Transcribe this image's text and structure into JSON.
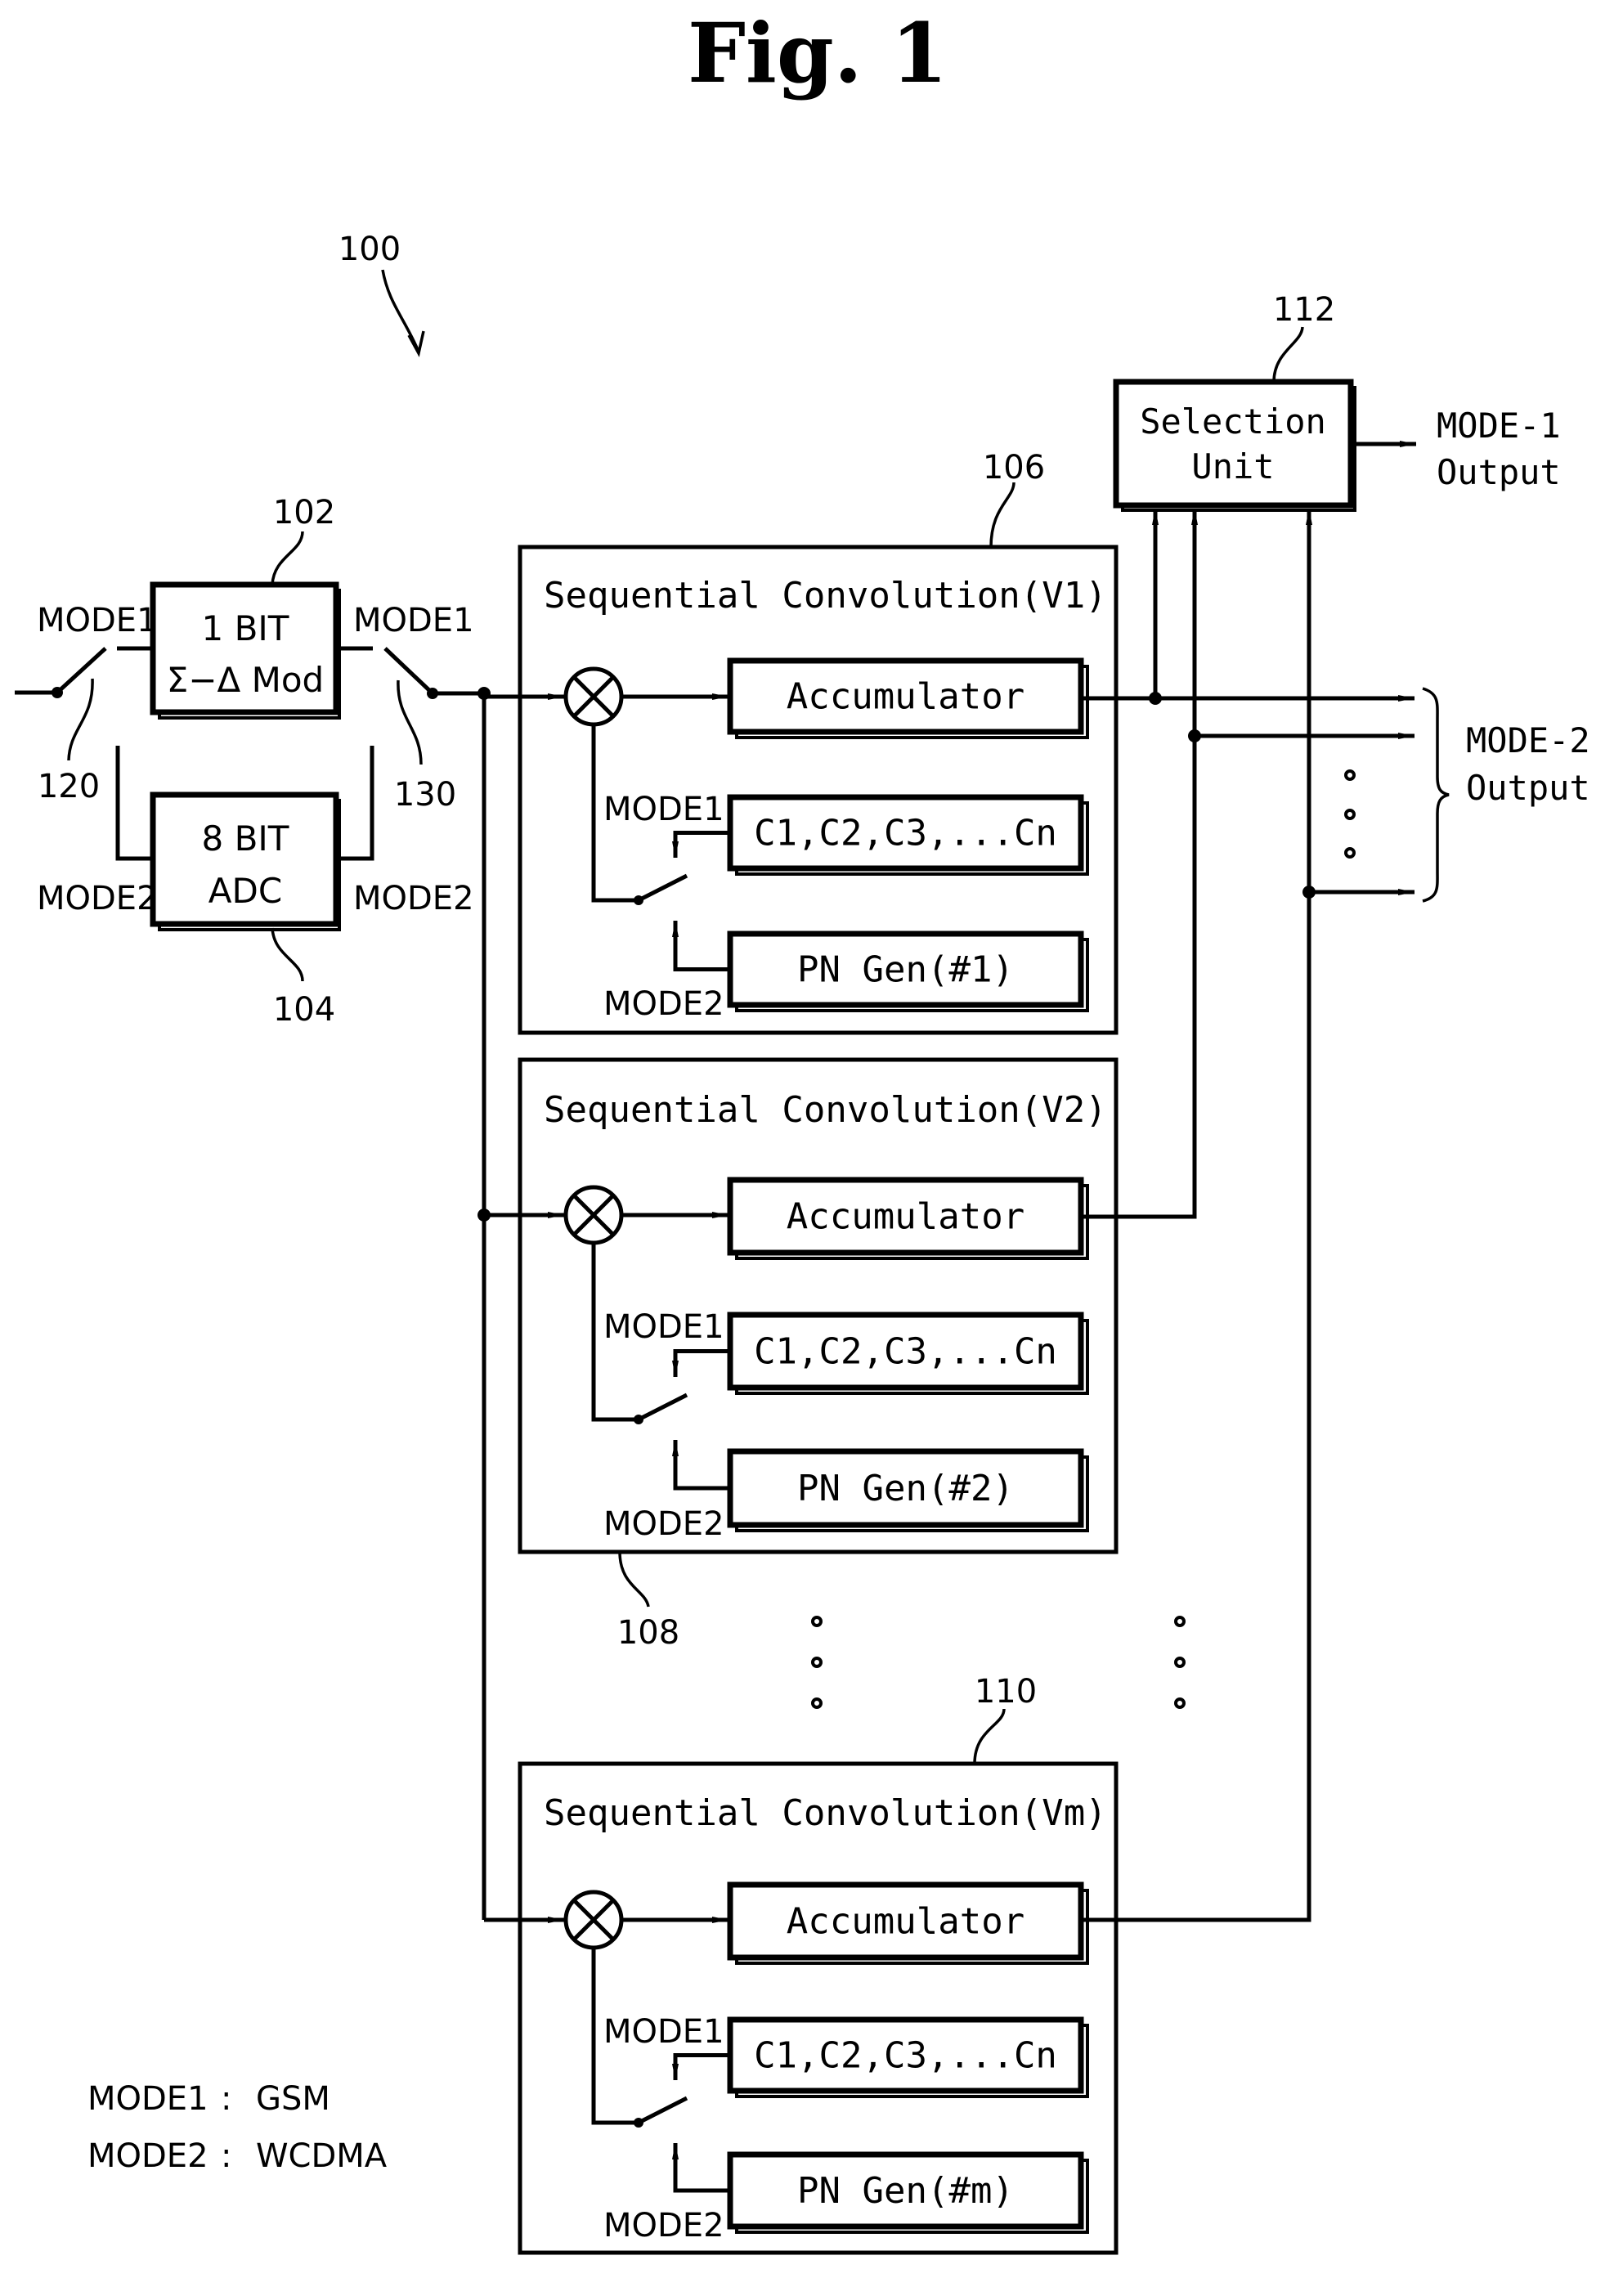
{
  "figure": {
    "title": "Fig. 1",
    "system_ref": "100"
  },
  "input_stage": {
    "switch_in": {
      "ref": "120",
      "mode1_label": "MODE1",
      "mode2_label": "MODE2"
    },
    "switch_out": {
      "ref": "130",
      "mode1_label": "MODE1",
      "mode2_label": "MODE2"
    },
    "modulator": {
      "ref": "102",
      "line1": "1 BIT",
      "line2": "Σ−Δ Mod"
    },
    "adc": {
      "ref": "104",
      "line1": "8 BIT",
      "line2": "ADC"
    }
  },
  "convolution_blocks": [
    {
      "ref": "106",
      "title": "Sequential Convolution(V1)",
      "accumulator": "Accumulator",
      "codes": "C1,C2,C3,...Cn",
      "pn": "PN Gen(#1)",
      "mode1_label": "MODE1",
      "mode2_label": "MODE2"
    },
    {
      "ref": "108",
      "title": "Sequential Convolution(V2)",
      "accumulator": "Accumulator",
      "codes": "C1,C2,C3,...Cn",
      "pn": "PN Gen(#2)",
      "mode1_label": "MODE1",
      "mode2_label": "MODE2"
    },
    {
      "ref": "110",
      "title": "Sequential Convolution(Vm)",
      "accumulator": "Accumulator",
      "codes": "C1,C2,C3,...Cn",
      "pn": "PN Gen(#m)",
      "mode1_label": "MODE1",
      "mode2_label": "MODE2"
    }
  ],
  "selection_unit": {
    "ref": "112",
    "line1": "Selection",
    "line2": "Unit"
  },
  "outputs": {
    "mode1_line1": "MODE-1",
    "mode1_line2": "Output",
    "mode2_line1": "MODE-2",
    "mode2_line2": "Output"
  },
  "legend": [
    {
      "mode": "MODE1",
      "sep": ":",
      "standard": "GSM"
    },
    {
      "mode": "MODE2",
      "sep": ":",
      "standard": "WCDMA"
    }
  ],
  "icons": {
    "multiplier": "circle-x-mixer-icon",
    "arrow": "arrowhead-icon",
    "switch": "spdt-switch-icon",
    "ellipsis": "vertical-dots-icon"
  }
}
